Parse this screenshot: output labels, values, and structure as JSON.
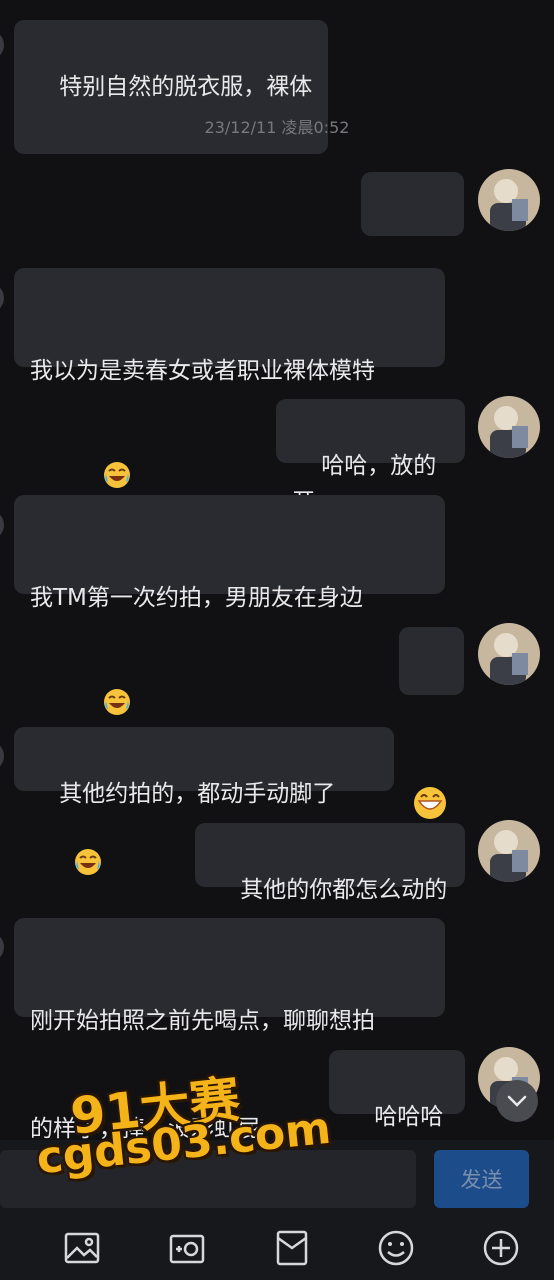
{
  "chat": {
    "timestamp": "23/12/11 凌晨0:52",
    "messages": [
      {
        "side": "left",
        "text": "特别自然的脱衣服，裸体",
        "emojis": []
      },
      {
        "side": "right",
        "text": "",
        "emojis": [
          "grin",
          "grin"
        ]
      },
      {
        "side": "left",
        "line1": "我以为是卖春女或者职业裸体模特",
        "emojis": [
          "joy"
        ]
      },
      {
        "side": "right",
        "text": "哈哈，放的开",
        "emojis": []
      },
      {
        "side": "left",
        "line1": "我TM第一次约拍，男朋友在身边",
        "emojis": [
          "joy"
        ]
      },
      {
        "side": "right",
        "text": "",
        "emojis": [
          "grin"
        ]
      },
      {
        "side": "left",
        "text": "其他约拍的，都动手动脚了",
        "emojis": [
          "joy"
        ]
      },
      {
        "side": "right",
        "text": "其他的你都怎么动的",
        "emojis": []
      },
      {
        "side": "left",
        "line1": "刚开始拍照之前先喝点，聊聊想拍",
        "line2": "的样子，捧一波彩虹屁",
        "emojis": []
      },
      {
        "side": "right",
        "text": "哈哈哈哈",
        "emojis": []
      }
    ]
  },
  "composer": {
    "send_label": "发送",
    "toolbar": [
      "image-icon",
      "camera-icon",
      "file-icon",
      "emoji-icon",
      "plus-icon"
    ]
  },
  "watermark": {
    "line1": "91大赛",
    "line2": "cgds03.com"
  },
  "colors": {
    "background": "#111114",
    "bubble": "#2a2b30",
    "send_button": "#1c4d8a",
    "watermark": "#f5b31a"
  }
}
